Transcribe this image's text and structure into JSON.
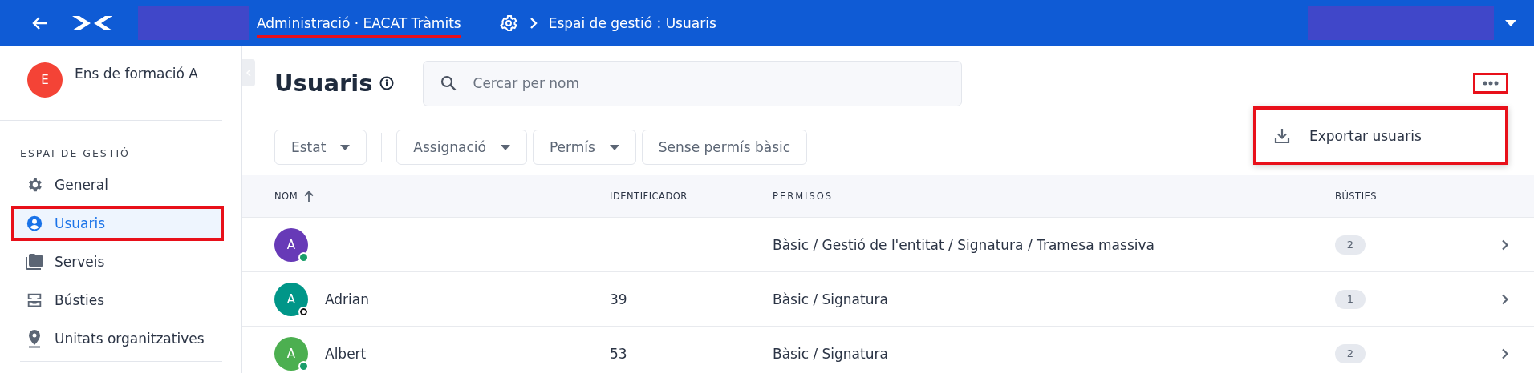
{
  "topbar": {
    "app_title": "Administració · EACAT Tràmits",
    "app_title_annotated": true,
    "breadcrumb": "Espai de gestió : Usuaris"
  },
  "sidebar": {
    "entity": {
      "initial": "E",
      "name": "Ens de formació A"
    },
    "section": "ESPAI DE GESTIÓ",
    "items": [
      {
        "kind": "gear",
        "label": "General",
        "selected": false,
        "annotated": false
      },
      {
        "kind": "person",
        "label": "Usuaris",
        "selected": true,
        "annotated": true
      },
      {
        "kind": "folder",
        "label": "Serveis",
        "selected": false,
        "annotated": false
      },
      {
        "kind": "inbox",
        "label": "Bústies",
        "selected": false,
        "annotated": false
      },
      {
        "kind": "pin",
        "label": "Unitats organitzatives",
        "selected": false,
        "annotated": false
      }
    ]
  },
  "main": {
    "title": "Usuaris",
    "search": {
      "placeholder": "Cercar per nom"
    },
    "more_annotated": true,
    "menu": {
      "annotated": true,
      "items": [
        {
          "label": "Exportar usuaris"
        }
      ]
    },
    "filters": [
      {
        "label": "Estat",
        "dropdown": true
      },
      {
        "label": "Assignació",
        "dropdown": true
      },
      {
        "label": "Permís",
        "dropdown": true
      },
      {
        "label": "Sense permís bàsic",
        "dropdown": false
      }
    ],
    "table": {
      "columns": [
        "NOM",
        "IDENTIFICADOR",
        "PERMISOS",
        "BÚSTIES"
      ],
      "rows": [
        {
          "initial": "A",
          "color": "#673ab7",
          "online": true,
          "permissions": "Bàsic / Gestió de l'entitat / Signatura / Tramesa massiva",
          "mailboxes": "2"
        },
        {
          "initial": "A",
          "color": "#009688",
          "online": false,
          "name": "Adrian",
          "id": "39",
          "permissions": "Bàsic / Signatura",
          "mailboxes": "1"
        },
        {
          "initial": "A",
          "color": "#4caf50",
          "online": true,
          "name": "Albert",
          "id": "53",
          "permissions": "Bàsic / Signatura",
          "mailboxes": "2"
        }
      ]
    }
  }
}
